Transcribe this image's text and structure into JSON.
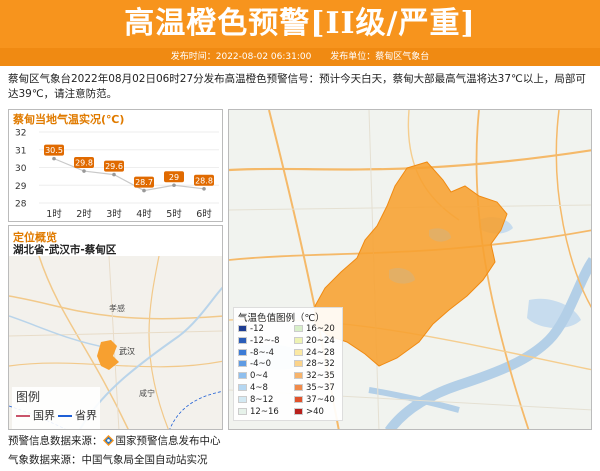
{
  "header": {
    "title": "高温橙色预警[II级/严重]",
    "publish_time_label": "发布时间：2022-08-02 06:31:00",
    "publisher_label": "发布单位：蔡甸区气象台",
    "accent_color": "#f7941d"
  },
  "description": "蔡甸区气象台2022年08月02日06时27分发布高温橙色预警信号：预计今天白天，蔡甸大部最高气温将达37℃以上，局部可达39℃，请注意防范。",
  "temperature_panel": {
    "title": "蔡甸当地气温实况(℃)",
    "chart_data": {
      "type": "line",
      "categories": [
        "1时",
        "2时",
        "3时",
        "4时",
        "5时",
        "6时"
      ],
      "values": [
        30.5,
        29.8,
        29.6,
        28.7,
        29,
        28.8
      ],
      "title": "蔡甸当地气温实况(℃)",
      "ylim": [
        28,
        32
      ],
      "yticks": [
        32,
        31,
        30,
        29,
        28
      ],
      "grid": true,
      "label_color": "#e06a00"
    }
  },
  "location_panel": {
    "title": "定位概览",
    "path": "湖北省-武汉市-蔡甸区",
    "map_labels": [
      "孝感",
      "武汉",
      "咸宁"
    ],
    "legend": {
      "title": "图例",
      "items": [
        {
          "label": "国界",
          "color": "#c9546b"
        },
        {
          "label": "省界",
          "color": "#1e5fd6"
        }
      ]
    }
  },
  "main_map": {
    "warning_area_color": "#f7a030",
    "color_legend": {
      "title": "气温色值图例（℃）",
      "items": [
        {
          "label": "-12",
          "color": "#1f3e93"
        },
        {
          "label": "-12~-8",
          "color": "#2b5db8"
        },
        {
          "label": "-8~-4",
          "color": "#3d7cd6"
        },
        {
          "label": "-4~0",
          "color": "#5f9be3"
        },
        {
          "label": "0~4",
          "color": "#8fbfee"
        },
        {
          "label": "4~8",
          "color": "#b5d7f2"
        },
        {
          "label": "8~12",
          "color": "#d3e9f3"
        },
        {
          "label": "12~16",
          "color": "#e6f2ea"
        },
        {
          "label": "16~20",
          "color": "#d8efc8"
        },
        {
          "label": "20~24",
          "color": "#eef3b3"
        },
        {
          "label": "24~28",
          "color": "#fbe9a3"
        },
        {
          "label": "28~32",
          "color": "#fbd38a"
        },
        {
          "label": "32~35",
          "color": "#f7b36b"
        },
        {
          "label": "35~37",
          "color": "#f08a4a"
        },
        {
          "label": "37~40",
          "color": "#e0522b"
        },
        {
          "label": ">40",
          "color": "#b8201c"
        }
      ]
    }
  },
  "footer": {
    "warning_source": "预警信息数据来源：",
    "warning_source_name": "国家预警信息发布中心",
    "weather_source": "气象数据来源：中国气象局全国自动站实况"
  }
}
